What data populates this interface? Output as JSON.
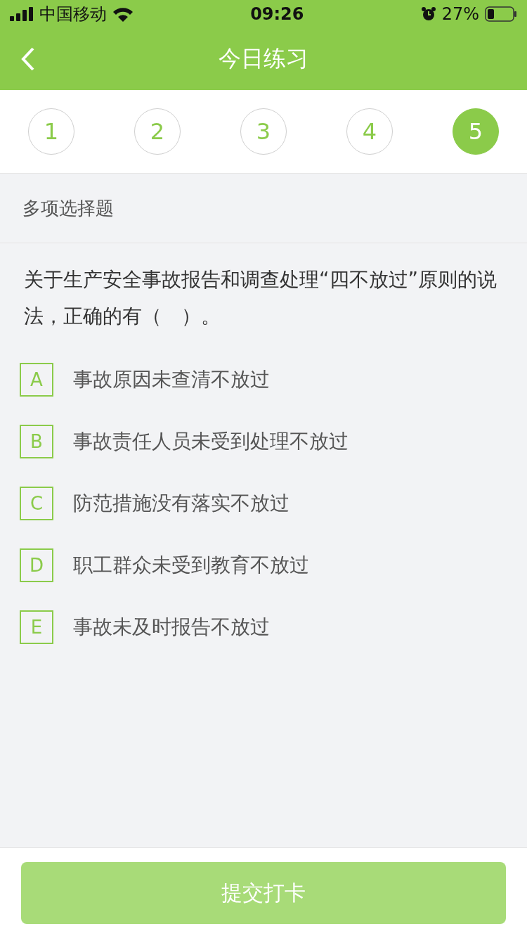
{
  "status_bar": {
    "carrier": "中国移动",
    "time": "09:26",
    "battery": "27%"
  },
  "nav": {
    "title": "今日练习"
  },
  "steps": [
    {
      "label": "1",
      "selected": false
    },
    {
      "label": "2",
      "selected": false
    },
    {
      "label": "3",
      "selected": false
    },
    {
      "label": "4",
      "selected": false
    },
    {
      "label": "5",
      "selected": true
    }
  ],
  "question_type": "多项选择题",
  "question": "关于生产安全事故报告和调查处理“四不放过”原则的说法，正确的有（　）。",
  "options": [
    {
      "letter": "A",
      "text": "事故原因未查清不放过",
      "checked": false
    },
    {
      "letter": "B",
      "text": "事故责任人员未受到处理不放过",
      "checked": false
    },
    {
      "letter": "C",
      "text": "防范措施没有落实不放过",
      "checked": false
    },
    {
      "letter": "D",
      "text": "职工群众未受到教育不放过",
      "checked": false
    },
    {
      "letter": "E",
      "text": "事故未及时报告不放过",
      "checked": false
    }
  ],
  "submit": {
    "label": "提交打卡",
    "disabled": true
  }
}
